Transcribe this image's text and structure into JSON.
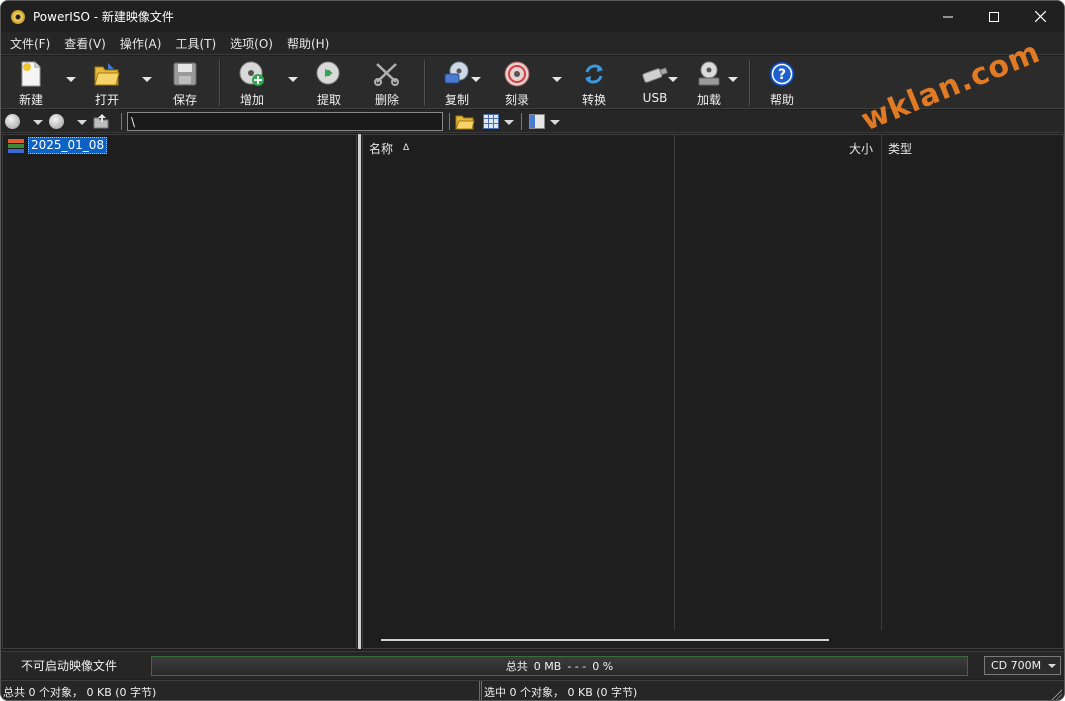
{
  "window": {
    "title": "PowerISO - 新建映像文件",
    "minimize_icon": "minimize-icon",
    "maximize_icon": "maximize-icon",
    "close_icon": "close-icon"
  },
  "menu": [
    "文件(F)",
    "查看(V)",
    "操作(A)",
    "工具(T)",
    "选项(O)",
    "帮助(H)"
  ],
  "toolbar": {
    "new": "新建",
    "open": "打开",
    "save": "保存",
    "add": "增加",
    "extract": "提取",
    "delete": "删除",
    "copy": "复制",
    "burn": "刻录",
    "convert": "转换",
    "usb": "USB",
    "mount": "加载",
    "help": "帮助"
  },
  "address": {
    "path": "\\"
  },
  "tree": {
    "root_label": "2025_01_08"
  },
  "list": {
    "columns": {
      "name": "名称",
      "size": "大小",
      "type": "类型"
    },
    "sort_indicator": "Δ"
  },
  "status": {
    "boot": "不可启动映像文件",
    "total_label": "总共",
    "total_size": "0 MB",
    "dashes": "- - -",
    "percent": "0 %",
    "fill_fraction": 0,
    "media": "CD 700M",
    "left": "总共 0 个对象，  0 KB (0 字节)",
    "right": "选中 0 个对象，  0 KB (0 字节)"
  },
  "watermark": "wklan.com",
  "colors": {
    "background": "#1e1e1e",
    "selection": "#0e62c4",
    "progress_border": "#3b6d3b",
    "watermark": "#e07a25"
  }
}
